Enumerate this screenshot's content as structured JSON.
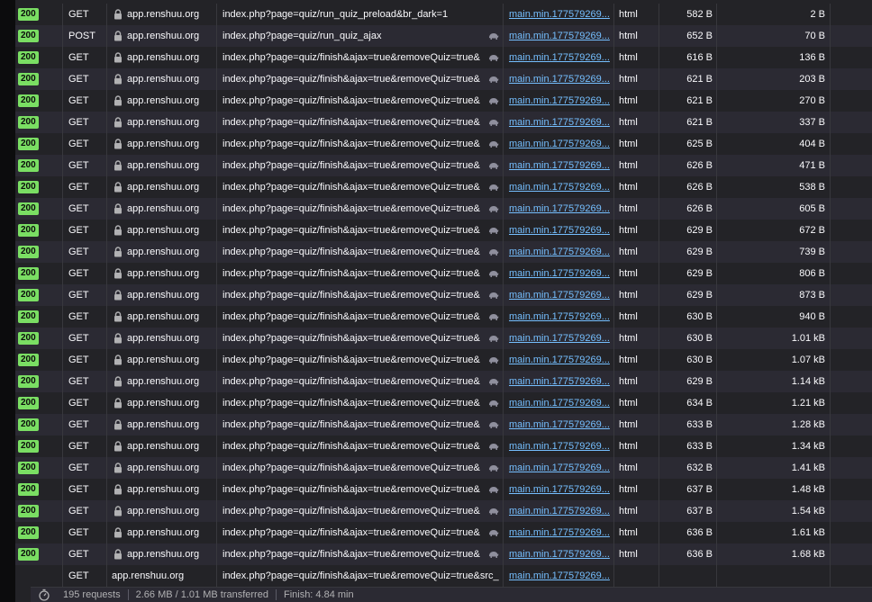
{
  "rows": [
    {
      "status": "200",
      "method": "GET",
      "domain": "app.renshuu.org",
      "file": "index.php?page=quiz/run_quiz_preload&br_dark=1",
      "tracker": false,
      "initiator": "main.min.177579269...",
      "type": "html",
      "transferred": "582 B",
      "size": "2 B"
    },
    {
      "status": "200",
      "method": "POST",
      "domain": "app.renshuu.org",
      "file": "index.php?page=quiz/run_quiz_ajax",
      "tracker": true,
      "initiator": "main.min.177579269...",
      "type": "html",
      "transferred": "652 B",
      "size": "70 B"
    },
    {
      "status": "200",
      "method": "GET",
      "domain": "app.renshuu.org",
      "file": "index.php?page=quiz/finish&ajax=true&removeQuiz=true&",
      "tracker": true,
      "initiator": "main.min.177579269...",
      "type": "html",
      "transferred": "616 B",
      "size": "136 B"
    },
    {
      "status": "200",
      "method": "GET",
      "domain": "app.renshuu.org",
      "file": "index.php?page=quiz/finish&ajax=true&removeQuiz=true&",
      "tracker": true,
      "initiator": "main.min.177579269...",
      "type": "html",
      "transferred": "621 B",
      "size": "203 B"
    },
    {
      "status": "200",
      "method": "GET",
      "domain": "app.renshuu.org",
      "file": "index.php?page=quiz/finish&ajax=true&removeQuiz=true&",
      "tracker": true,
      "initiator": "main.min.177579269...",
      "type": "html",
      "transferred": "621 B",
      "size": "270 B"
    },
    {
      "status": "200",
      "method": "GET",
      "domain": "app.renshuu.org",
      "file": "index.php?page=quiz/finish&ajax=true&removeQuiz=true&",
      "tracker": true,
      "initiator": "main.min.177579269...",
      "type": "html",
      "transferred": "621 B",
      "size": "337 B"
    },
    {
      "status": "200",
      "method": "GET",
      "domain": "app.renshuu.org",
      "file": "index.php?page=quiz/finish&ajax=true&removeQuiz=true&",
      "tracker": true,
      "initiator": "main.min.177579269...",
      "type": "html",
      "transferred": "625 B",
      "size": "404 B"
    },
    {
      "status": "200",
      "method": "GET",
      "domain": "app.renshuu.org",
      "file": "index.php?page=quiz/finish&ajax=true&removeQuiz=true&",
      "tracker": true,
      "initiator": "main.min.177579269...",
      "type": "html",
      "transferred": "626 B",
      "size": "471 B"
    },
    {
      "status": "200",
      "method": "GET",
      "domain": "app.renshuu.org",
      "file": "index.php?page=quiz/finish&ajax=true&removeQuiz=true&",
      "tracker": true,
      "initiator": "main.min.177579269...",
      "type": "html",
      "transferred": "626 B",
      "size": "538 B"
    },
    {
      "status": "200",
      "method": "GET",
      "domain": "app.renshuu.org",
      "file": "index.php?page=quiz/finish&ajax=true&removeQuiz=true&",
      "tracker": true,
      "initiator": "main.min.177579269...",
      "type": "html",
      "transferred": "626 B",
      "size": "605 B"
    },
    {
      "status": "200",
      "method": "GET",
      "domain": "app.renshuu.org",
      "file": "index.php?page=quiz/finish&ajax=true&removeQuiz=true&",
      "tracker": true,
      "initiator": "main.min.177579269...",
      "type": "html",
      "transferred": "629 B",
      "size": "672 B"
    },
    {
      "status": "200",
      "method": "GET",
      "domain": "app.renshuu.org",
      "file": "index.php?page=quiz/finish&ajax=true&removeQuiz=true&",
      "tracker": true,
      "initiator": "main.min.177579269...",
      "type": "html",
      "transferred": "629 B",
      "size": "739 B"
    },
    {
      "status": "200",
      "method": "GET",
      "domain": "app.renshuu.org",
      "file": "index.php?page=quiz/finish&ajax=true&removeQuiz=true&",
      "tracker": true,
      "initiator": "main.min.177579269...",
      "type": "html",
      "transferred": "629 B",
      "size": "806 B"
    },
    {
      "status": "200",
      "method": "GET",
      "domain": "app.renshuu.org",
      "file": "index.php?page=quiz/finish&ajax=true&removeQuiz=true&",
      "tracker": true,
      "initiator": "main.min.177579269...",
      "type": "html",
      "transferred": "629 B",
      "size": "873 B"
    },
    {
      "status": "200",
      "method": "GET",
      "domain": "app.renshuu.org",
      "file": "index.php?page=quiz/finish&ajax=true&removeQuiz=true&",
      "tracker": true,
      "initiator": "main.min.177579269...",
      "type": "html",
      "transferred": "630 B",
      "size": "940 B"
    },
    {
      "status": "200",
      "method": "GET",
      "domain": "app.renshuu.org",
      "file": "index.php?page=quiz/finish&ajax=true&removeQuiz=true&",
      "tracker": true,
      "initiator": "main.min.177579269...",
      "type": "html",
      "transferred": "630 B",
      "size": "1.01 kB"
    },
    {
      "status": "200",
      "method": "GET",
      "domain": "app.renshuu.org",
      "file": "index.php?page=quiz/finish&ajax=true&removeQuiz=true&",
      "tracker": true,
      "initiator": "main.min.177579269...",
      "type": "html",
      "transferred": "630 B",
      "size": "1.07 kB"
    },
    {
      "status": "200",
      "method": "GET",
      "domain": "app.renshuu.org",
      "file": "index.php?page=quiz/finish&ajax=true&removeQuiz=true&",
      "tracker": true,
      "initiator": "main.min.177579269...",
      "type": "html",
      "transferred": "629 B",
      "size": "1.14 kB"
    },
    {
      "status": "200",
      "method": "GET",
      "domain": "app.renshuu.org",
      "file": "index.php?page=quiz/finish&ajax=true&removeQuiz=true&",
      "tracker": true,
      "initiator": "main.min.177579269...",
      "type": "html",
      "transferred": "634 B",
      "size": "1.21 kB"
    },
    {
      "status": "200",
      "method": "GET",
      "domain": "app.renshuu.org",
      "file": "index.php?page=quiz/finish&ajax=true&removeQuiz=true&",
      "tracker": true,
      "initiator": "main.min.177579269...",
      "type": "html",
      "transferred": "633 B",
      "size": "1.28 kB"
    },
    {
      "status": "200",
      "method": "GET",
      "domain": "app.renshuu.org",
      "file": "index.php?page=quiz/finish&ajax=true&removeQuiz=true&",
      "tracker": true,
      "initiator": "main.min.177579269...",
      "type": "html",
      "transferred": "633 B",
      "size": "1.34 kB"
    },
    {
      "status": "200",
      "method": "GET",
      "domain": "app.renshuu.org",
      "file": "index.php?page=quiz/finish&ajax=true&removeQuiz=true&",
      "tracker": true,
      "initiator": "main.min.177579269...",
      "type": "html",
      "transferred": "632 B",
      "size": "1.41 kB"
    },
    {
      "status": "200",
      "method": "GET",
      "domain": "app.renshuu.org",
      "file": "index.php?page=quiz/finish&ajax=true&removeQuiz=true&",
      "tracker": true,
      "initiator": "main.min.177579269...",
      "type": "html",
      "transferred": "637 B",
      "size": "1.48 kB"
    },
    {
      "status": "200",
      "method": "GET",
      "domain": "app.renshuu.org",
      "file": "index.php?page=quiz/finish&ajax=true&removeQuiz=true&",
      "tracker": true,
      "initiator": "main.min.177579269...",
      "type": "html",
      "transferred": "637 B",
      "size": "1.54 kB"
    },
    {
      "status": "200",
      "method": "GET",
      "domain": "app.renshuu.org",
      "file": "index.php?page=quiz/finish&ajax=true&removeQuiz=true&",
      "tracker": true,
      "initiator": "main.min.177579269...",
      "type": "html",
      "transferred": "636 B",
      "size": "1.61 kB"
    },
    {
      "status": "200",
      "method": "GET",
      "domain": "app.renshuu.org",
      "file": "index.php?page=quiz/finish&ajax=true&removeQuiz=true&",
      "tracker": true,
      "initiator": "main.min.177579269...",
      "type": "html",
      "transferred": "636 B",
      "size": "1.68 kB"
    },
    {
      "status": "",
      "method": "GET",
      "domain": "app.renshuu.org",
      "file": "index.php?page=quiz/finish&ajax=true&removeQuiz=true&src_",
      "tracker": false,
      "initiator": "main.min.177579269...",
      "type": "",
      "transferred": "",
      "size": "",
      "pending": true
    }
  ],
  "statusbar": {
    "icon": "stopwatch-icon",
    "requests": "195 requests",
    "transferred": "2.66 MB / 1.01 MB transferred",
    "finish": "Finish: 4.84 min"
  },
  "colors": {
    "status_ok": "#7ade63",
    "link": "#75bfff",
    "row_odd": "#232327",
    "row_even": "#2b2a33"
  }
}
